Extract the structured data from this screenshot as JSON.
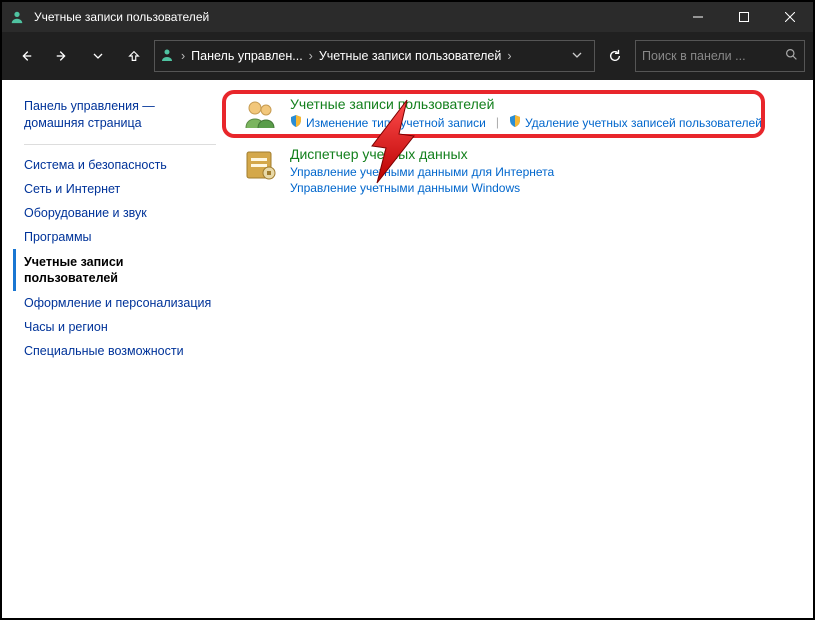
{
  "window": {
    "title": "Учетные записи пользователей"
  },
  "breadcrumb": {
    "root": "Панель управлен...",
    "current": "Учетные записи пользователей"
  },
  "search": {
    "placeholder": "Поиск в панели ..."
  },
  "sidebar": {
    "home": "Панель управления — домашняя страница",
    "items": [
      {
        "label": "Система и безопасность"
      },
      {
        "label": "Сеть и Интернет"
      },
      {
        "label": "Оборудование и звук"
      },
      {
        "label": "Программы"
      },
      {
        "label": "Учетные записи пользователей",
        "active": true
      },
      {
        "label": "Оформление и персонализация"
      },
      {
        "label": "Часы и регион"
      },
      {
        "label": "Специальные возможности"
      }
    ]
  },
  "main": {
    "groups": [
      {
        "title": "Учетные записи пользователей",
        "links": [
          {
            "label": "Изменение типа учетной записи",
            "shield": true
          },
          {
            "label": "Удаление учетных записей пользователей",
            "shield": true
          }
        ],
        "highlighted": true
      },
      {
        "title": "Диспетчер учетных данных",
        "links": [
          {
            "label": "Управление учетными данными для Интернета",
            "shield": false
          },
          {
            "label": "Управление учетными данными Windows",
            "shield": false
          }
        ]
      }
    ]
  }
}
